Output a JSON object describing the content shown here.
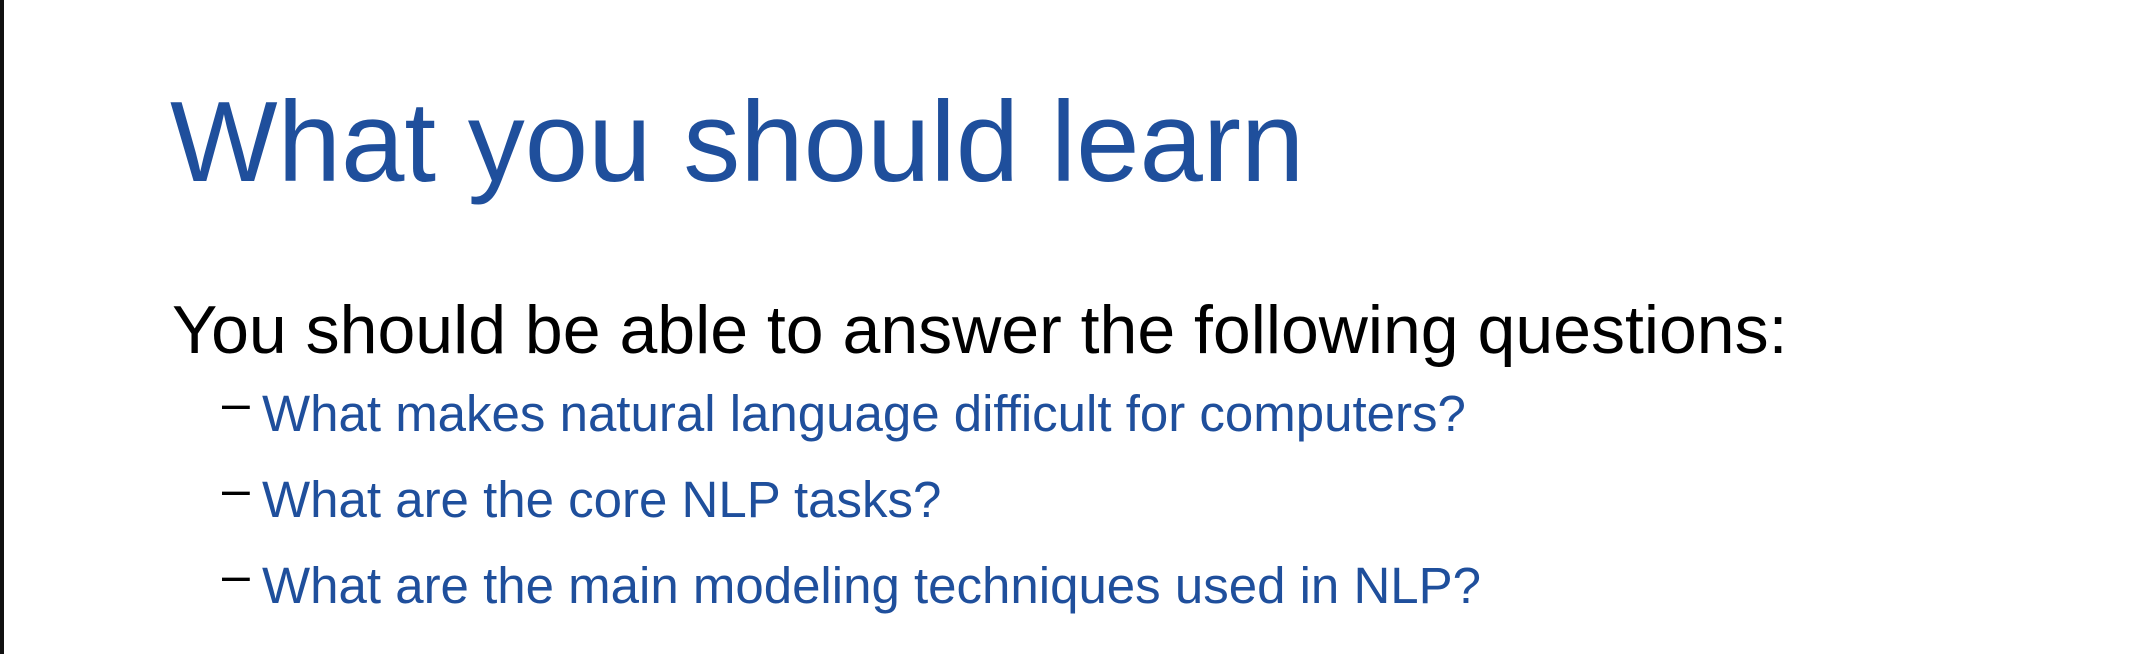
{
  "slide": {
    "title": "What you should learn",
    "intro": "You should be able to answer the following questions:",
    "dash": "–",
    "questions": [
      "What makes natural language difficult for computers?",
      "What are the core NLP tasks?",
      "What are the main modeling techniques used in NLP?"
    ]
  },
  "colors": {
    "title": "#1f4f9c",
    "question": "#1f4f9c",
    "intro": "#000000"
  }
}
